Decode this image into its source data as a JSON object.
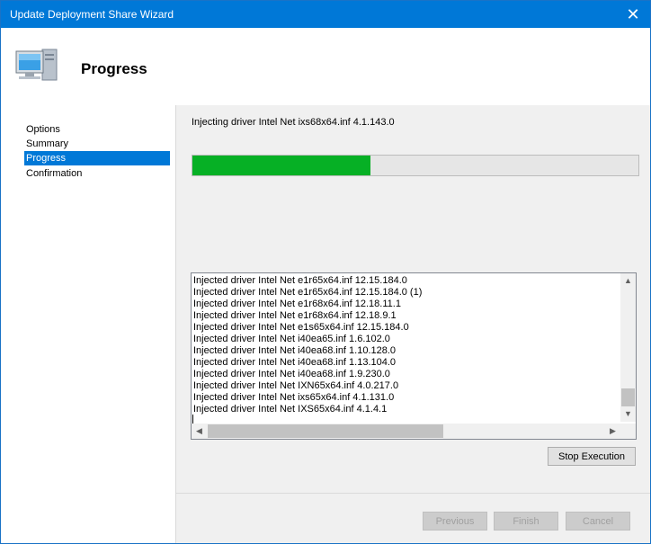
{
  "window": {
    "title": "Update Deployment Share Wizard",
    "close_glyph": "✕"
  },
  "header": {
    "heading": "Progress",
    "icon": "computer-icon"
  },
  "nav": {
    "items": [
      {
        "label": "Options",
        "active": false
      },
      {
        "label": "Summary",
        "active": false
      },
      {
        "label": "Progress",
        "active": true
      },
      {
        "label": "Confirmation",
        "active": false
      }
    ]
  },
  "main": {
    "status_text": "Injecting driver Intel Net ixs68x64.inf 4.1.143.0",
    "progress_percent": 40,
    "progress_color": "#06b025",
    "log_lines": [
      "Injected driver Intel Net e1r65x64.inf 12.15.184.0",
      "Injected driver Intel Net e1r65x64.inf 12.15.184.0 (1)",
      "Injected driver Intel Net e1r68x64.inf 12.18.11.1",
      "Injected driver Intel Net e1r68x64.inf 12.18.9.1",
      "Injected driver Intel Net e1s65x64.inf 12.15.184.0",
      "Injected driver Intel Net i40ea65.inf 1.6.102.0",
      "Injected driver Intel Net i40ea68.inf 1.10.128.0",
      "Injected driver Intel Net i40ea68.inf 1.13.104.0",
      "Injected driver Intel Net i40ea68.inf 1.9.230.0",
      "Injected driver Intel Net IXN65x64.inf 4.0.217.0",
      "Injected driver Intel Net ixs65x64.inf 4.1.131.0",
      "Injected driver Intel Net IXS65x64.inf 4.1.4.1"
    ],
    "stop_button": "Stop Execution"
  },
  "footer": {
    "previous": "Previous",
    "finish": "Finish",
    "cancel": "Cancel"
  },
  "colors": {
    "accent": "#0078d7"
  }
}
